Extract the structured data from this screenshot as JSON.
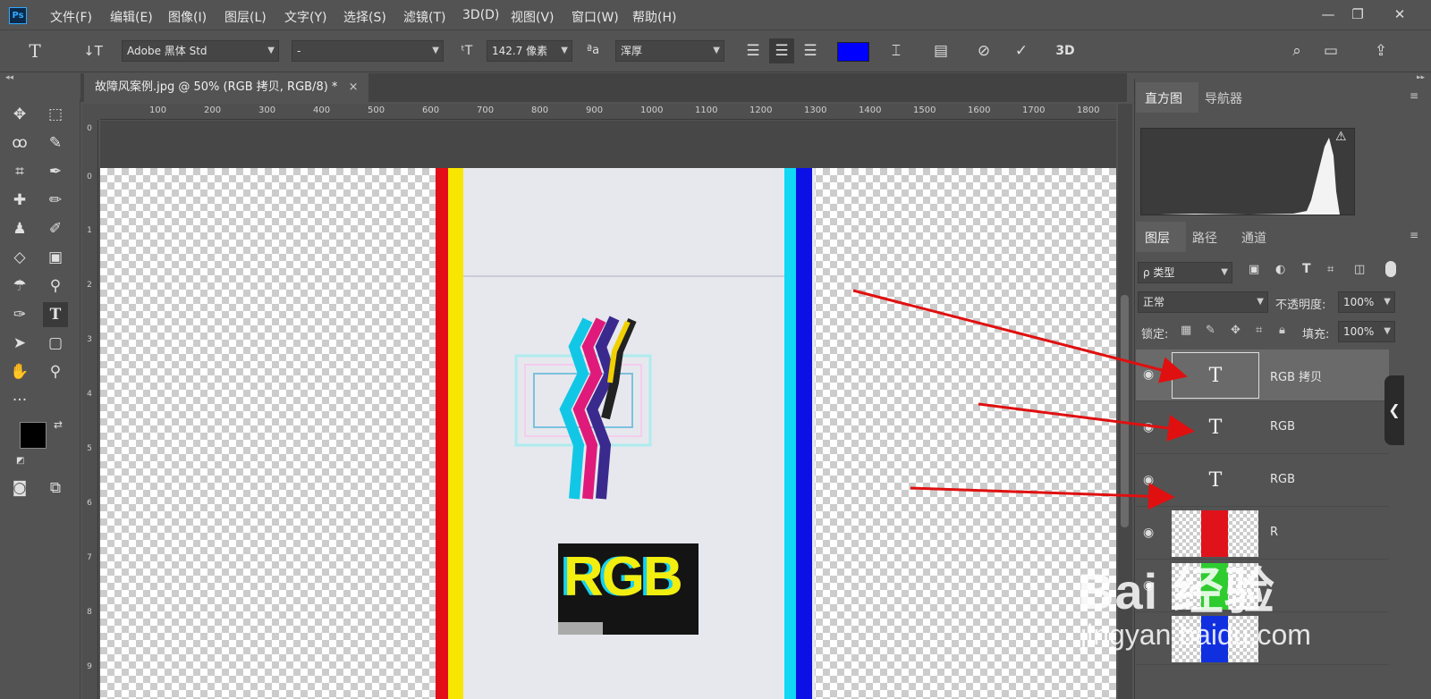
{
  "app": {
    "logo": "Ps"
  },
  "menu": [
    "文件(F)",
    "编辑(E)",
    "图像(I)",
    "图层(L)",
    "文字(Y)",
    "选择(S)",
    "滤镜(T)",
    "3D(D)",
    "视图(V)",
    "窗口(W)",
    "帮助(H)"
  ],
  "window": {
    "minimize": "—",
    "restore": "❐",
    "close": "✕"
  },
  "options": {
    "font_family": "Adobe 黑体 Std",
    "font_style": "-",
    "font_size": "142.7 像素",
    "aa_label": "ªa",
    "antialias": "浑厚",
    "color": "#0000ff",
    "threed": "3D"
  },
  "document": {
    "tab_title": "故障风案例.jpg @ 50% (RGB 拷贝, RGB/8) *",
    "close": "×"
  },
  "ruler": {
    "top": [
      "100",
      "200",
      "300",
      "400",
      "500",
      "600",
      "700",
      "800",
      "900",
      "1000",
      "1100",
      "1200",
      "1300",
      "1400",
      "1500",
      "1600",
      "1700",
      "1800"
    ],
    "left": [
      "0",
      "1",
      "2",
      "3",
      "4",
      "5",
      "6",
      "7",
      "8",
      "9"
    ],
    "left_small": "0"
  },
  "canvas": {
    "logo_text": "RGB"
  },
  "panels": {
    "top_tabs": [
      "直方图",
      "导航器"
    ],
    "layer_tabs": [
      "图层",
      "路径",
      "通道"
    ],
    "filter_kind": "ρ 类型",
    "blend_mode": "正常",
    "opacity_label": "不透明度:",
    "opacity_value": "100%",
    "lock_label": "锁定:",
    "fill_label": "填充:",
    "fill_value": "100%"
  },
  "layers": [
    {
      "name": "RGB 拷贝",
      "type": "text",
      "selected": true
    },
    {
      "name": "RGB",
      "type": "text"
    },
    {
      "name": "RGB",
      "type": "text"
    },
    {
      "name": "R",
      "type": "image",
      "color": "#e0131b"
    },
    {
      "name": "",
      "type": "image",
      "color": "#2ecc2e"
    },
    {
      "name": "",
      "type": "image",
      "color": "#1030e0"
    }
  ],
  "watermark": {
    "line1": "Bai 经验",
    "line2": "jingyan.baidu.com"
  },
  "colors": {
    "arrow": "#e01010",
    "fg": "#000000",
    "bg": "#ffffff"
  }
}
